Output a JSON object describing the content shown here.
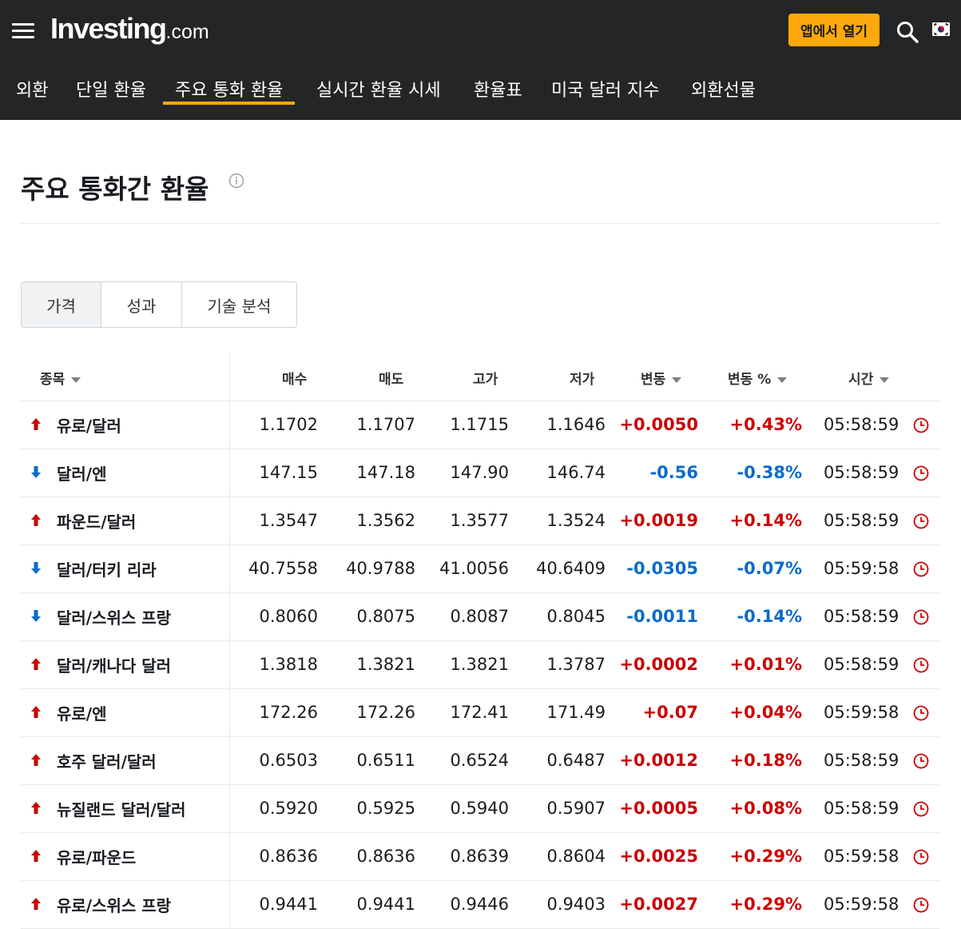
{
  "header": {
    "logo_main": "Investing",
    "logo_suffix": ".com",
    "app_button": "앱에서 열기"
  },
  "nav": {
    "items": [
      {
        "label": "외환",
        "active": false
      },
      {
        "label": "단일 환율",
        "active": false
      },
      {
        "label": "주요 통화 환율",
        "active": true
      },
      {
        "label": "실시간 환율 시세",
        "active": false
      },
      {
        "label": "환율표",
        "active": false
      },
      {
        "label": "미국 달러 지수",
        "active": false
      },
      {
        "label": "외환선물",
        "active": false
      }
    ]
  },
  "page": {
    "title": "주요 통화간 환율"
  },
  "tabs": [
    {
      "label": "가격",
      "active": true
    },
    {
      "label": "성과",
      "active": false
    },
    {
      "label": "기술 분석",
      "active": false
    }
  ],
  "table": {
    "headers": {
      "name": "종목",
      "bid": "매수",
      "ask": "매도",
      "high": "고가",
      "low": "저가",
      "change": "변동",
      "change_pct": "변동 %",
      "time": "시간"
    },
    "rows": [
      {
        "name": "유로/달러",
        "dir": "up",
        "bid": "1.1702",
        "ask": "1.1707",
        "high": "1.1715",
        "low": "1.1646",
        "change": "+0.0050",
        "change_pct": "+0.43%",
        "time": "05:58:59"
      },
      {
        "name": "달러/엔",
        "dir": "down",
        "bid": "147.15",
        "ask": "147.18",
        "high": "147.90",
        "low": "146.74",
        "change": "-0.56",
        "change_pct": "-0.38%",
        "time": "05:58:59"
      },
      {
        "name": "파운드/달러",
        "dir": "up",
        "bid": "1.3547",
        "ask": "1.3562",
        "high": "1.3577",
        "low": "1.3524",
        "change": "+0.0019",
        "change_pct": "+0.14%",
        "time": "05:58:59"
      },
      {
        "name": "달러/터키 리라",
        "dir": "down",
        "bid": "40.7558",
        "ask": "40.9788",
        "high": "41.0056",
        "low": "40.6409",
        "change": "-0.0305",
        "change_pct": "-0.07%",
        "time": "05:59:58"
      },
      {
        "name": "달러/스위스 프랑",
        "dir": "down",
        "bid": "0.8060",
        "ask": "0.8075",
        "high": "0.8087",
        "low": "0.8045",
        "change": "-0.0011",
        "change_pct": "-0.14%",
        "time": "05:58:59"
      },
      {
        "name": "달러/캐나다 달러",
        "dir": "up",
        "bid": "1.3818",
        "ask": "1.3821",
        "high": "1.3821",
        "low": "1.3787",
        "change": "+0.0002",
        "change_pct": "+0.01%",
        "time": "05:58:59"
      },
      {
        "name": "유로/엔",
        "dir": "up",
        "bid": "172.26",
        "ask": "172.26",
        "high": "172.41",
        "low": "171.49",
        "change": "+0.07",
        "change_pct": "+0.04%",
        "time": "05:59:58"
      },
      {
        "name": "호주 달러/달러",
        "dir": "up",
        "bid": "0.6503",
        "ask": "0.6511",
        "high": "0.6524",
        "low": "0.6487",
        "change": "+0.0012",
        "change_pct": "+0.18%",
        "time": "05:58:59"
      },
      {
        "name": "뉴질랜드 달러/달러",
        "dir": "up",
        "bid": "0.5920",
        "ask": "0.5925",
        "high": "0.5940",
        "low": "0.5907",
        "change": "+0.0005",
        "change_pct": "+0.08%",
        "time": "05:58:59"
      },
      {
        "name": "유로/파운드",
        "dir": "up",
        "bid": "0.8636",
        "ask": "0.8636",
        "high": "0.8639",
        "low": "0.8604",
        "change": "+0.0025",
        "change_pct": "+0.29%",
        "time": "05:59:58"
      },
      {
        "name": "유로/스위스 프랑",
        "dir": "up",
        "bid": "0.9441",
        "ask": "0.9441",
        "high": "0.9446",
        "low": "0.9403",
        "change": "+0.0027",
        "change_pct": "+0.29%",
        "time": "05:59:58"
      }
    ]
  },
  "colors": {
    "header_bg": "#232526",
    "accent": "#ffa80b",
    "up": "#cc0000",
    "down": "#0b6bcc"
  },
  "icons": {
    "menu": "hamburger-icon",
    "search": "search-icon",
    "flag": "korea-flag-icon",
    "info": "info-icon",
    "up": "arrow-up-icon",
    "down": "arrow-down-icon",
    "clock": "clock-icon"
  }
}
